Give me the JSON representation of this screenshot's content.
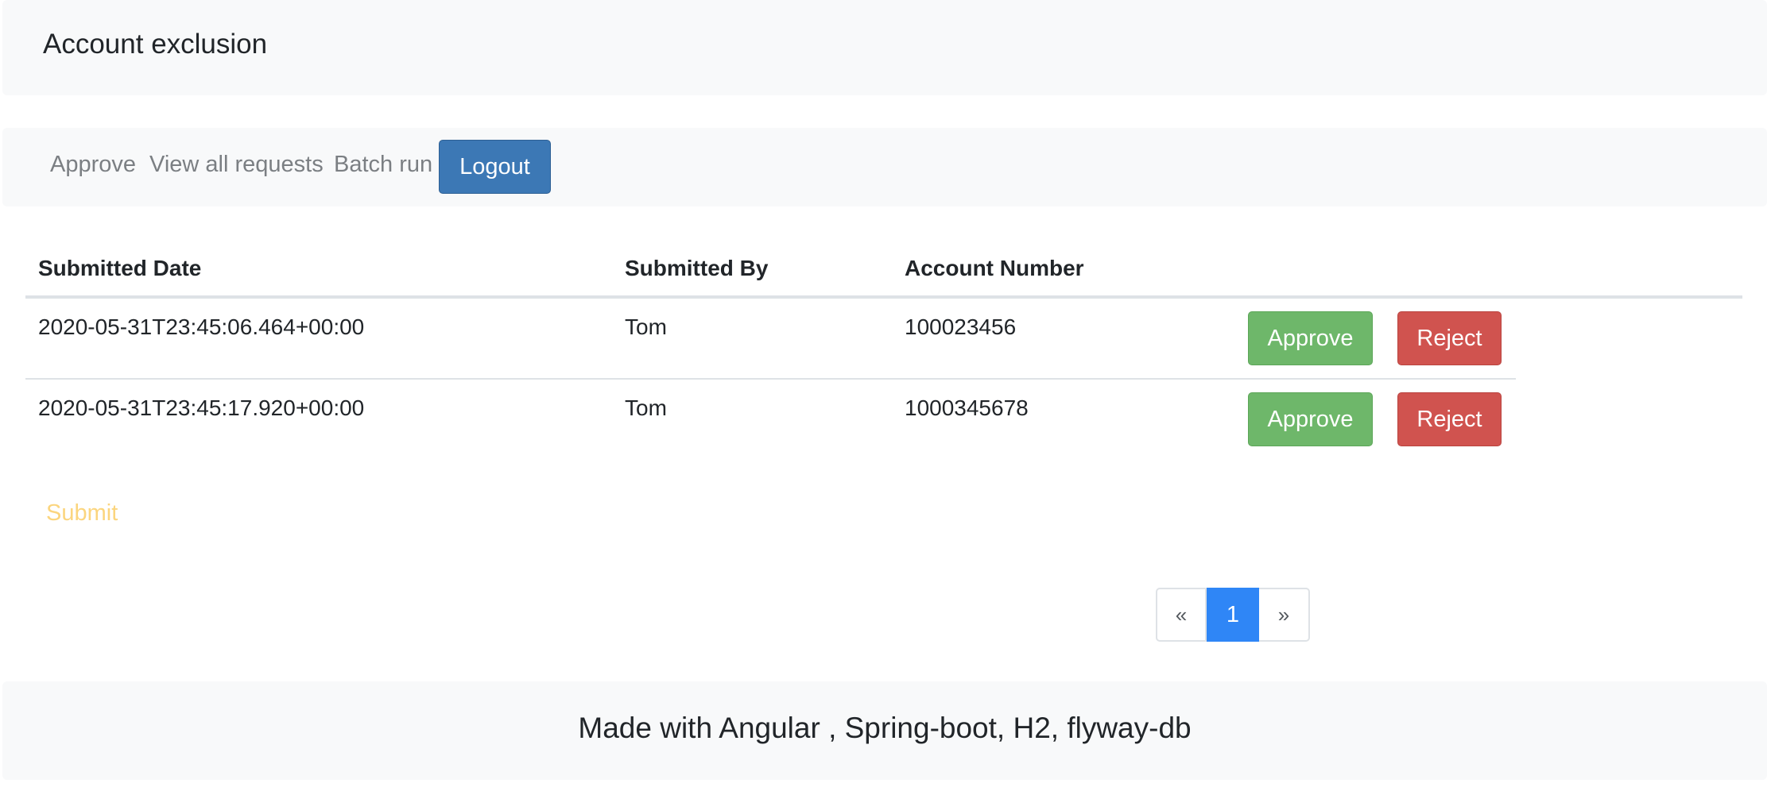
{
  "header": {
    "title": "Account exclusion"
  },
  "nav": {
    "items": [
      "Approve",
      "View all requests",
      "Batch run"
    ],
    "logout_label": "Logout"
  },
  "table": {
    "columns": [
      "Submitted Date",
      "Submitted By",
      "Account Number"
    ],
    "rows": [
      {
        "submitted_date": "2020-05-31T23:45:06.464+00:00",
        "submitted_by": "Tom",
        "account_number": "100023456",
        "approve_label": "Approve",
        "reject_label": "Reject"
      },
      {
        "submitted_date": "2020-05-31T23:45:17.920+00:00",
        "submitted_by": "Tom",
        "account_number": "1000345678",
        "approve_label": "Approve",
        "reject_label": "Reject"
      }
    ]
  },
  "submit_label": "Submit",
  "pagination": {
    "prev": "«",
    "current": "1",
    "next": "»"
  },
  "footer": {
    "text": "Made with Angular , Spring-boot, H2, flyway-db"
  },
  "colors": {
    "primary": "#3c78b5",
    "approve": "#6eb76a",
    "reject": "#d0534f",
    "submit_text": "#fbd57e",
    "page_active": "#2f86f6",
    "panel_bg": "#f8f9fa"
  }
}
